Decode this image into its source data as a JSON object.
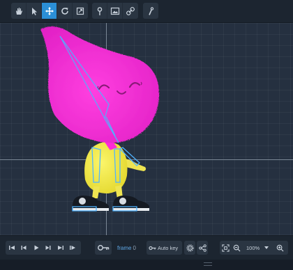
{
  "toolbar": {
    "tools": [
      {
        "icon": "hand-icon",
        "active": false
      },
      {
        "icon": "pointer-icon",
        "active": false
      },
      {
        "icon": "move-icon",
        "active": true
      },
      {
        "icon": "rotate-icon",
        "active": false
      },
      {
        "icon": "scale-icon",
        "active": false
      },
      {
        "icon": "pin-icon",
        "active": false
      },
      {
        "icon": "image-icon",
        "active": false
      },
      {
        "icon": "bone-link-icon",
        "active": false
      },
      {
        "icon": "bone-draw-icon",
        "active": false
      }
    ]
  },
  "colors": {
    "accent": "#2b8fd6",
    "canvas": "#253040",
    "character_body": "#ff2bd8",
    "character_legs": "#f2ea45",
    "bone_overlay": "#4fb3ff"
  },
  "timeline": {
    "playback": [
      "skip-start-icon",
      "step-back-icon",
      "play-icon",
      "step-forward-icon",
      "skip-end-icon",
      "loop-icon"
    ],
    "frame_label": "frame",
    "frame_value": "0",
    "auto_key_label": "Auto key",
    "zoom_value": "100%"
  }
}
